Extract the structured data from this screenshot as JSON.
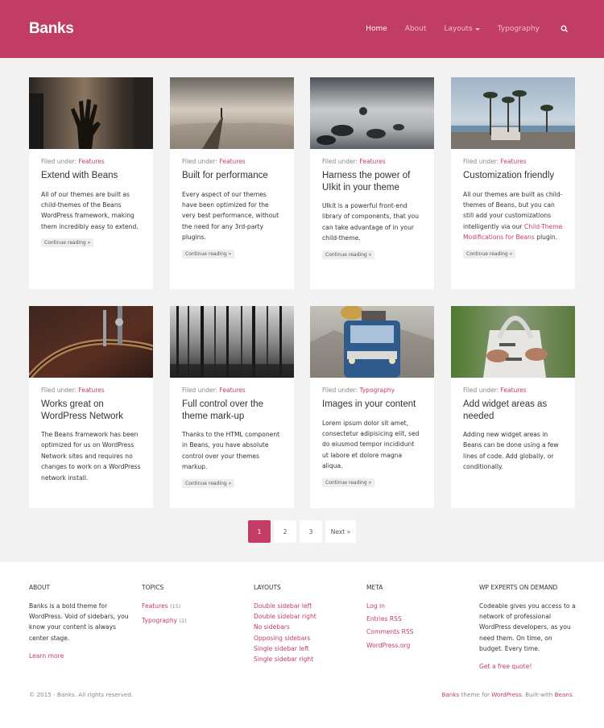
{
  "site": {
    "logo": "Banks"
  },
  "nav": {
    "items": [
      {
        "label": "Home"
      },
      {
        "label": "About"
      },
      {
        "label": "Layouts"
      },
      {
        "label": "Typography"
      }
    ]
  },
  "colors": {
    "accent": "#c23d66",
    "background": "#f2f2f2"
  },
  "posts": [
    {
      "filed_label": "Filed under:",
      "category": "Features",
      "title": "Extend with Beans",
      "excerpt": "All of our themes are built as child-themes of the Beans WordPress framework, making them incredibly easy to extend.",
      "more": "Continue reading »"
    },
    {
      "filed_label": "Filed under:",
      "category": "Features",
      "title": "Built for performance",
      "excerpt": "Every aspect of our themes have been optimized for the very best performance, without the need for any 3rd-party plugins.",
      "more": "Continue reading »"
    },
    {
      "filed_label": "Filed under:",
      "category": "Features",
      "title": "Harness the power of UIkit in your theme",
      "excerpt": "UIkit is a powerful front-end library of components, that you can take advantage of in your child-theme.",
      "more": "Continue reading »"
    },
    {
      "filed_label": "Filed under:",
      "category": "Features",
      "title": "Customization friendly",
      "excerpt_a": "All our themes are built as child-themes of Beans, but you can still add your customizations intelligently via our",
      "excerpt_link": "Child-Theme Modifications for Beans",
      "excerpt_b": "plugin.",
      "more": "Continue reading »"
    },
    {
      "filed_label": "Filed under:",
      "category": "Features",
      "title": "Works great on WordPress Network",
      "excerpt": "The Beans framework has been optimized for us on WordPress Network sites and requires no changes to work on a WordPress network install."
    },
    {
      "filed_label": "Filed under:",
      "category": "Features",
      "title": "Full control over the theme mark-up",
      "excerpt": "Thanks to the HTML component in Beans, you have absolute control over your themes markup.",
      "more": "Continue reading »"
    },
    {
      "filed_label": "Filed under:",
      "category": "Typography",
      "title": "Images in your content",
      "excerpt": "Lorem ipsum dolor sit amet, consectetur adipisicing elit, sed do eiusmod tempor incididunt ut labore et dolore magna aliqua.",
      "more": "Continue reading »"
    },
    {
      "filed_label": "Filed under:",
      "category": "Features",
      "title": "Add widget areas as needed",
      "excerpt": "Adding new widget areas in Beans can be done using a few lines of code. Add globally, or conditionally."
    }
  ],
  "pagination": {
    "pages": [
      "1",
      "2",
      "3"
    ],
    "next": "Next »",
    "current": "1"
  },
  "footer": {
    "about": {
      "heading": "ABOUT",
      "text": "Banks is a bold theme for WordPress. Void of sidebars, you know your content is always center stage.",
      "link": "Learn more"
    },
    "topics": {
      "heading": "TOPICS",
      "items": [
        {
          "label": "Features",
          "count": "(15)"
        },
        {
          "label": "Typography",
          "count": "(2)"
        }
      ]
    },
    "layouts": {
      "heading": "LAYOUTS",
      "items": [
        "Double sidebar left",
        "Double sidebar right",
        "No sidebars",
        "Opposing sidebars",
        "Single sidebar left",
        "Single sidebar right"
      ]
    },
    "meta": {
      "heading": "META",
      "items": [
        "Log in",
        "Entries RSS",
        "Comments RSS",
        "WordPress.org"
      ]
    },
    "experts": {
      "heading": "WP EXPERTS ON DEMAND",
      "text": "Codeable gives you access to a network of professional WordPress developers, as you need them. On time, on budget. Every time.",
      "link": "Get a free quote!"
    },
    "copyright": "© 2015 - Banks. All rights reserved.",
    "credit": {
      "theme": "Banks",
      "mid1": " theme for ",
      "wp": "WordPress",
      "mid2": ". Built-with ",
      "beans": "Beans",
      "end": "."
    }
  }
}
